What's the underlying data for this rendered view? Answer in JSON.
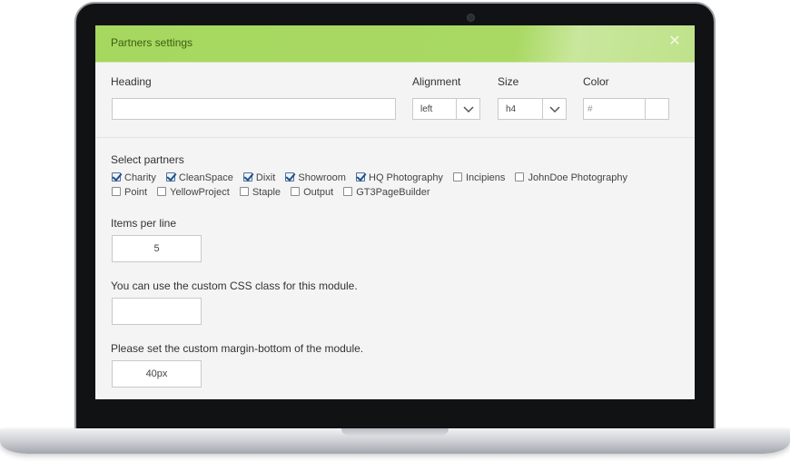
{
  "modal": {
    "title": "Partners settings"
  },
  "fields": {
    "heading_label": "Heading",
    "heading_value": "",
    "alignment_label": "Alignment",
    "alignment_value": "left",
    "size_label": "Size",
    "size_value": "h4",
    "color_label": "Color",
    "color_hash": "#"
  },
  "partners": {
    "label": "Select partners",
    "items": [
      {
        "name": "Charity",
        "checked": true
      },
      {
        "name": "CleanSpace",
        "checked": true
      },
      {
        "name": "Dixit",
        "checked": true
      },
      {
        "name": "Showroom",
        "checked": true
      },
      {
        "name": "HQ Photography",
        "checked": true
      },
      {
        "name": "Incipiens",
        "checked": false
      },
      {
        "name": "JohnDoe Photography",
        "checked": false
      },
      {
        "name": "Point",
        "checked": false
      },
      {
        "name": "YellowProject",
        "checked": false
      },
      {
        "name": "Staple",
        "checked": false
      },
      {
        "name": "Output",
        "checked": false
      },
      {
        "name": "GT3PageBuilder",
        "checked": false
      }
    ]
  },
  "items_per_line": {
    "label": "Items per line",
    "value": "5"
  },
  "css_class": {
    "label": "You can use the custom CSS class for this module.",
    "value": ""
  },
  "margin_bottom": {
    "label": "Please set the custom margin-bottom of the module.",
    "value": "40px"
  },
  "colors": {
    "header_green": "#a6d75f",
    "title_text": "#3b5e12"
  }
}
